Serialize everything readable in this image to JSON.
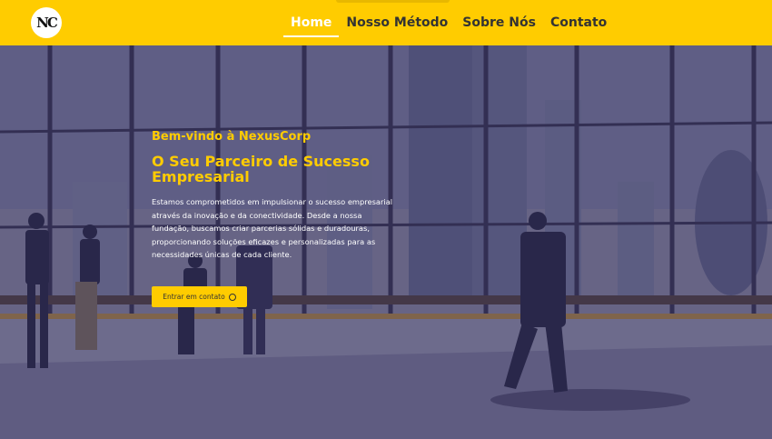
{
  "brand": {
    "logo_text": "NC"
  },
  "nav": {
    "items": [
      {
        "label": "Home",
        "active": true
      },
      {
        "label": "Nosso Método",
        "active": false
      },
      {
        "label": "Sobre Nós",
        "active": false
      },
      {
        "label": "Contato",
        "active": false
      }
    ]
  },
  "hero": {
    "welcome": "Bem-vindo à NexusCorp",
    "headline": "O Seu Parceiro de Sucesso Empresarial",
    "description": "Estamos comprometidos em impulsionar o sucesso empresarial através da inovação e da conectividade. Desde a nossa fundação, buscamos criar parcerias sólidas e duradouras, proporcionando soluções eficazes e personalizadas para as necessidades únicas de cada cliente.",
    "cta_label": "Entrar em contato",
    "cta_icon": "whatsapp-icon"
  },
  "colors": {
    "accent": "#ffcc00",
    "overlay": "#28245a",
    "text_light": "#ffffff"
  }
}
